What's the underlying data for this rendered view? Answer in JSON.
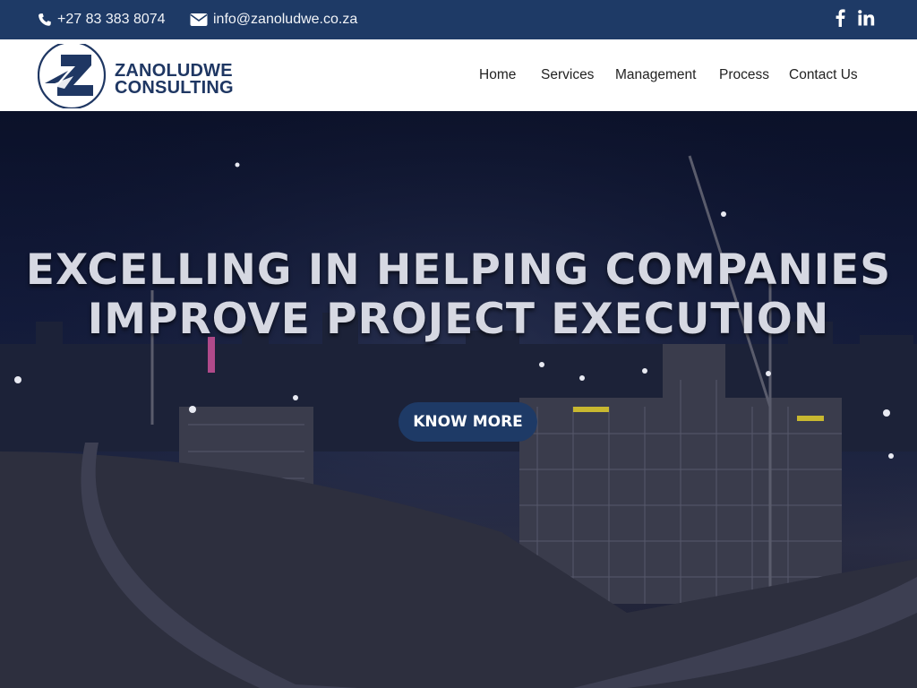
{
  "topbar": {
    "phone": "+27 83 383 8074",
    "email": "info@zanoludwe.co.za",
    "social": [
      "facebook-icon",
      "linkedin-icon"
    ],
    "background": "#1e3a66"
  },
  "brand": {
    "line1": "ZANOLUDWE",
    "line2": "CONSULTING",
    "color": "#1f3763"
  },
  "nav": {
    "items": [
      "Home",
      "Services",
      "Management",
      "Process",
      "Contact Us"
    ]
  },
  "hero": {
    "headline_line1": "EXCELLING IN HELPING COMPANIES",
    "headline_line2": "IMPROVE PROJECT EXECUTION",
    "cta_label": "KNOW MORE",
    "cta_color": "#1e3a66"
  }
}
